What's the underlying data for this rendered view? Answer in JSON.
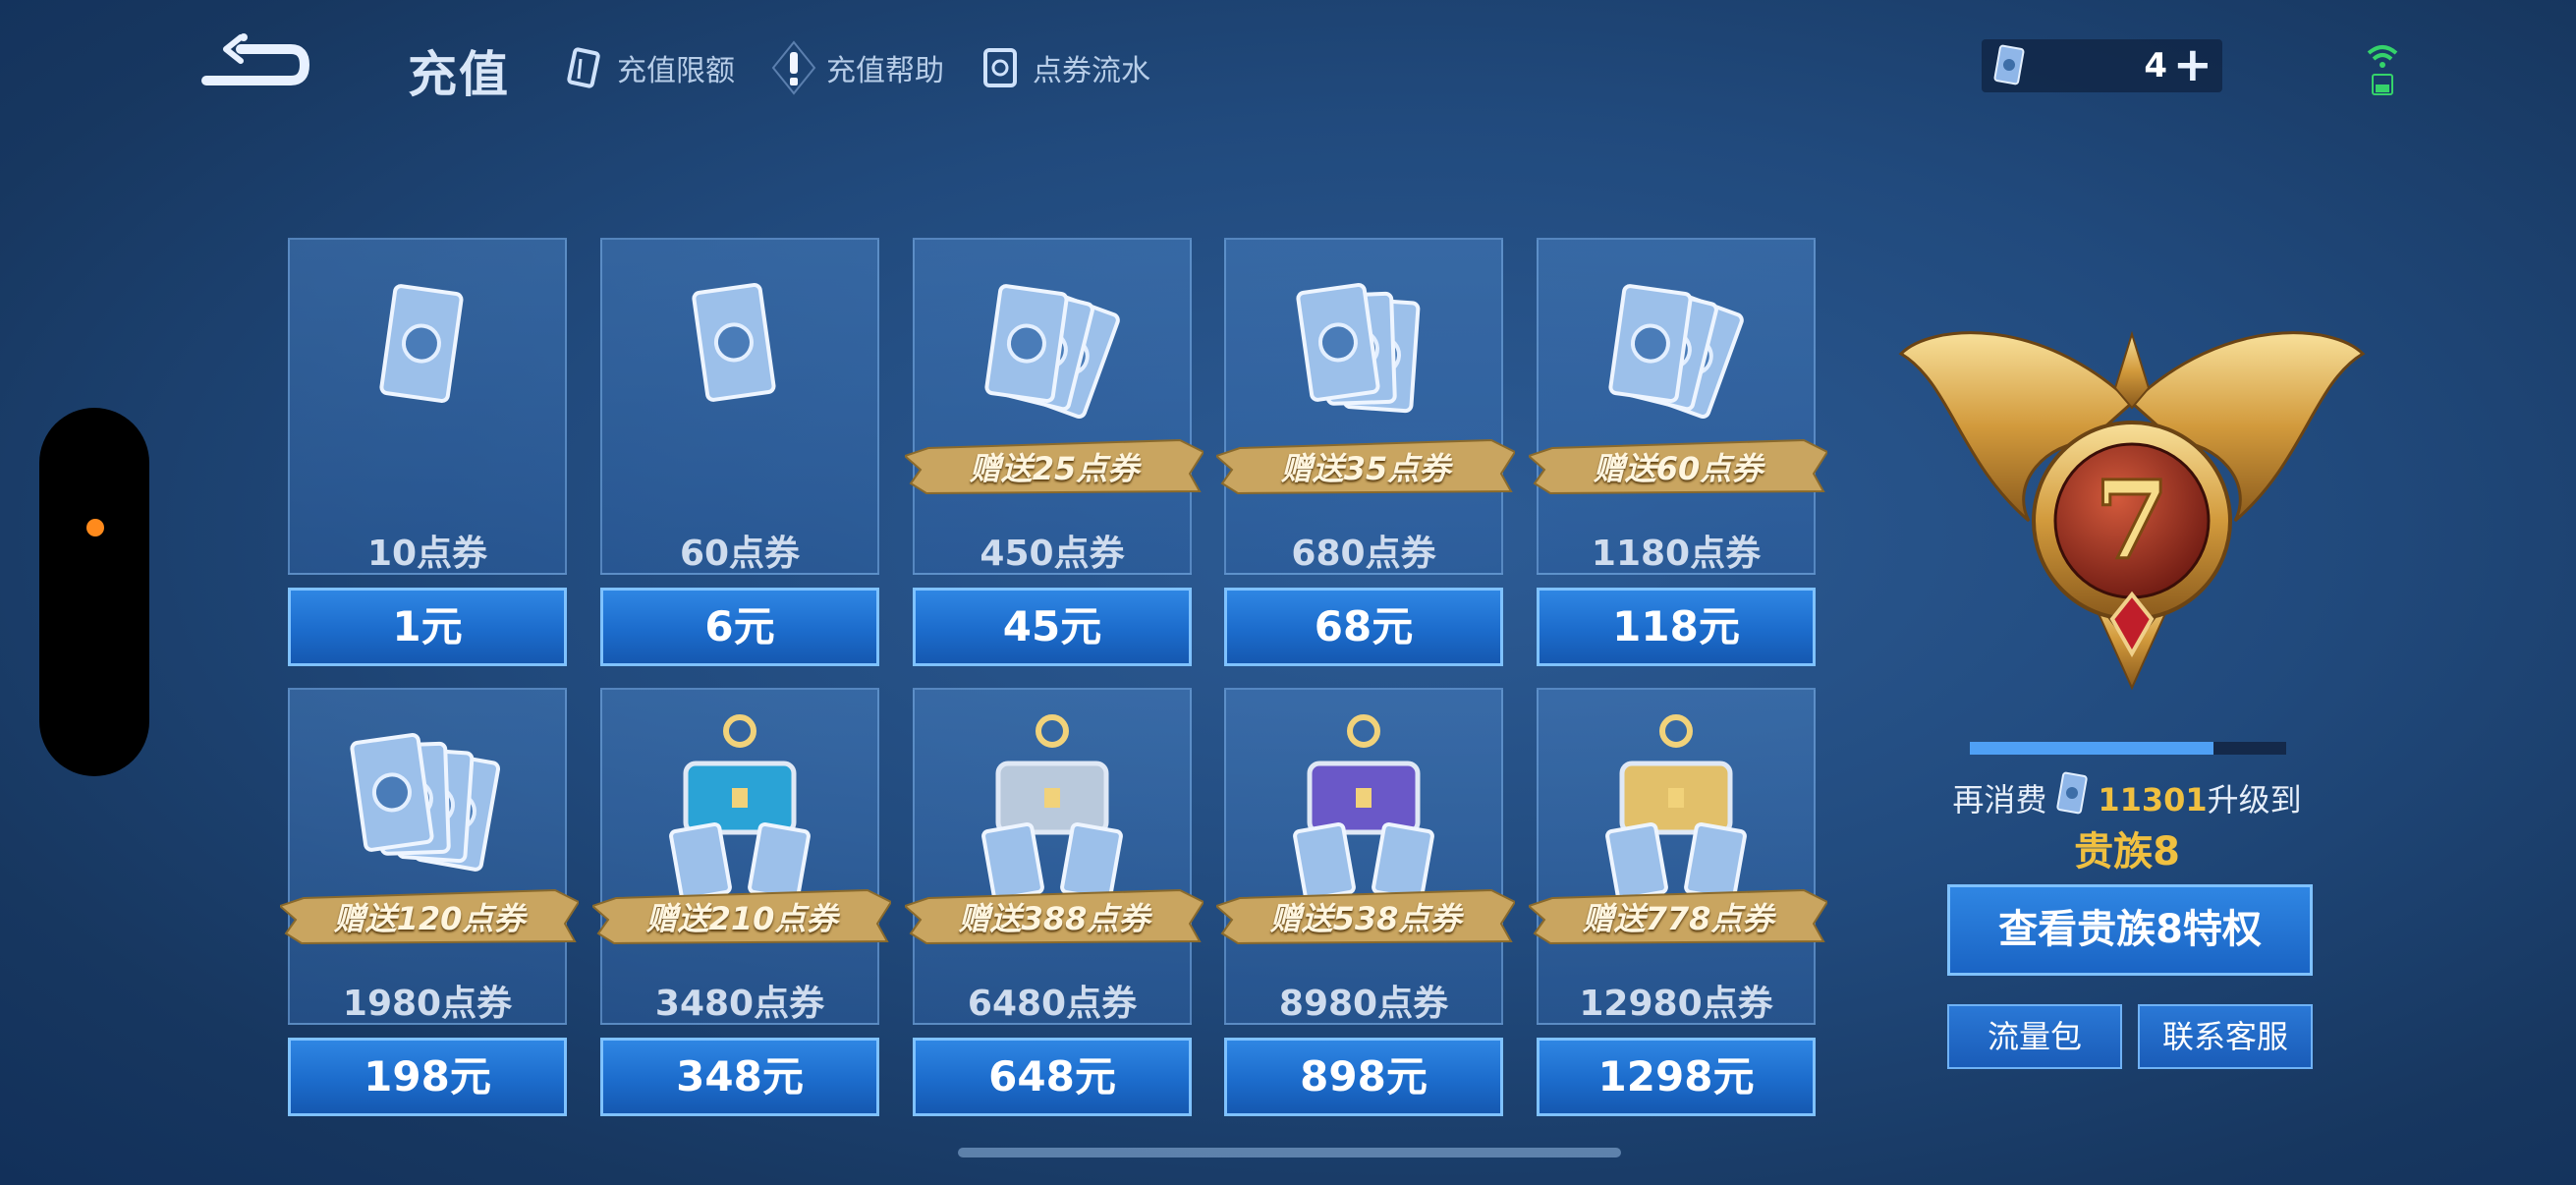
{
  "header": {
    "title": "充值",
    "links": [
      {
        "label": "充值限额",
        "icon": "coupon-card-icon"
      },
      {
        "label": "充值帮助",
        "icon": "exclamation-icon"
      },
      {
        "label": "点券流水",
        "icon": "coupon-record-icon"
      }
    ],
    "currency": {
      "amount": "4",
      "plus": "+"
    }
  },
  "items": [
    {
      "qty": "10点券",
      "price": "1元",
      "bonus": ""
    },
    {
      "qty": "60点券",
      "price": "6元",
      "bonus": ""
    },
    {
      "qty": "450点券",
      "price": "45元",
      "bonus": "赠送25点券"
    },
    {
      "qty": "680点券",
      "price": "68元",
      "bonus": "赠送35点券"
    },
    {
      "qty": "1180点券",
      "price": "118元",
      "bonus": "赠送60点券"
    },
    {
      "qty": "1980点券",
      "price": "198元",
      "bonus": "赠送120点券"
    },
    {
      "qty": "3480点券",
      "price": "348元",
      "bonus": "赠送210点券"
    },
    {
      "qty": "6480点券",
      "price": "648元",
      "bonus": "赠送388点券"
    },
    {
      "qty": "8980点券",
      "price": "898元",
      "bonus": "赠送538点券"
    },
    {
      "qty": "12980点券",
      "price": "1298元",
      "bonus": "赠送778点券"
    }
  ],
  "vip": {
    "level": "7",
    "progress": 0.77,
    "prefix": "再消费",
    "amount": "11301",
    "suffix": "升级到",
    "next_level": "贵族8",
    "view_button": "查看贵族8特权",
    "traffic_button": "流量包",
    "service_button": "联系客服"
  },
  "colors": {
    "accent_gold": "#f0c040",
    "button_blue": "#1c6ccc",
    "side_dot": "#ff8a1c"
  }
}
